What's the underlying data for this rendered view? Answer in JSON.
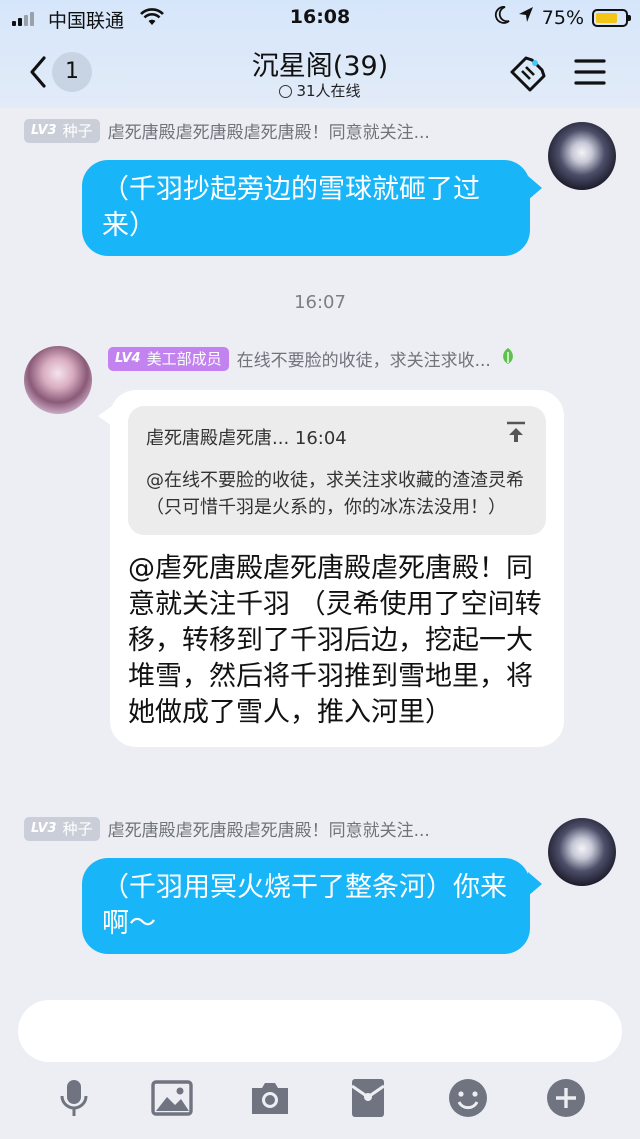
{
  "status_bar": {
    "carrier": "中国联通",
    "time": "16:08",
    "battery": "75%"
  },
  "header": {
    "back_count": "1",
    "title": "沉星阁(39)",
    "online": "31人在线"
  },
  "messages": [
    {
      "side": "right",
      "level": "LV3",
      "tag": "种子",
      "sender": "虐死唐殿虐死唐殿虐死唐殿！同意就关注...",
      "text": "（千羽抄起旁边的雪球就砸了过来）"
    },
    {
      "timestamp": "16:07"
    },
    {
      "side": "left",
      "level": "LV4",
      "tag": "美工部成员",
      "sender": "在线不要脸的收徒，求关注求收...",
      "quote_head": "虐死唐殿虐死唐... 16:04",
      "quote_body": "@在线不要脸的收徒，求关注求收藏的渣渣灵希 （只可惜千羽是火系的，你的冰冻法没用！）",
      "text": "@虐死唐殿虐死唐殿虐死唐殿！同意就关注千羽 （灵希使用了空间转移，转移到了千羽后边，挖起一大堆雪，然后将千羽推到雪地里，将她做成了雪人，推入河里）"
    },
    {
      "side": "right",
      "level": "LV3",
      "tag": "种子",
      "sender": "虐死唐殿虐死唐殿虐死唐殿！同意就关注...",
      "text": "（千羽用冥火烧干了整条河）你来啊～"
    }
  ],
  "input": {
    "placeholder": ""
  },
  "toolbar": [
    "microphone-icon",
    "image-icon",
    "camera-icon",
    "red-packet-icon",
    "emoji-icon",
    "plus-icon"
  ],
  "colors": {
    "bubble_blue": "#18b6f8",
    "tag_grey": "#c9ced8",
    "tag_purple": "#c283f0",
    "header_bg": "#d6e6fa"
  }
}
